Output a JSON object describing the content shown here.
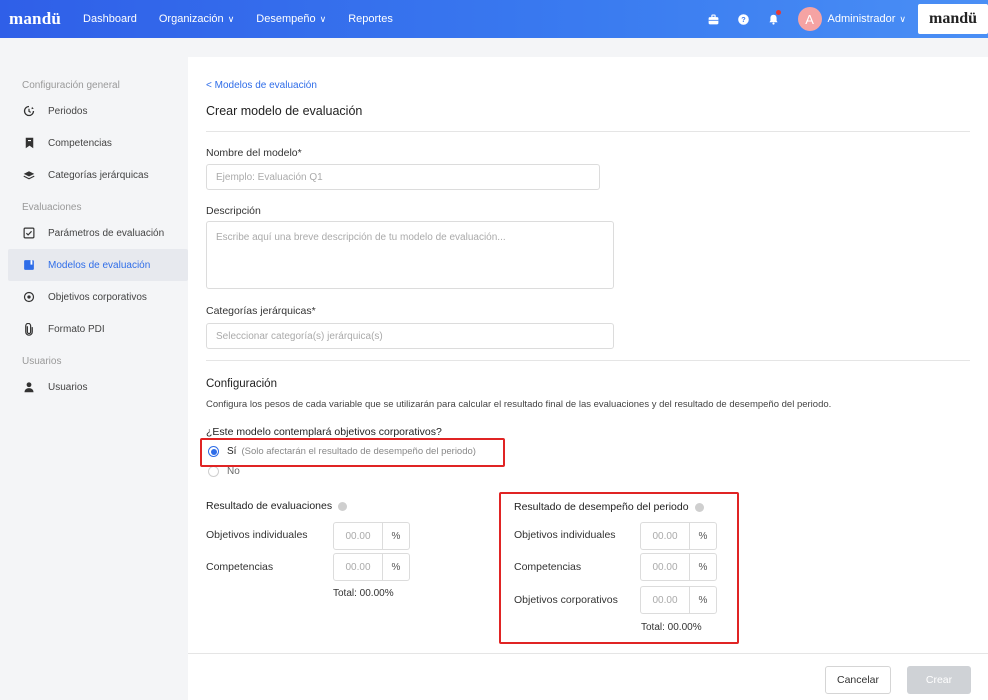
{
  "topbar": {
    "brand": "mandü",
    "nav": [
      {
        "label": "Dashboard",
        "has_dropdown": false
      },
      {
        "label": "Organización",
        "has_dropdown": true
      },
      {
        "label": "Desempeño",
        "has_dropdown": true
      },
      {
        "label": "Reportes",
        "has_dropdown": false
      }
    ],
    "avatar_initial": "A",
    "user_label": "Administrador",
    "brand_right": "mandü",
    "icons": [
      "briefcase-icon",
      "help-icon",
      "bell-icon"
    ]
  },
  "sidebar": {
    "sections": [
      {
        "title": "Configuración general",
        "items": [
          {
            "label": "Periodos",
            "icon": "clock-icon",
            "active": false
          },
          {
            "label": "Competencias",
            "icon": "bookmark-icon",
            "active": false
          },
          {
            "label": "Categorías jerárquicas",
            "icon": "layers-icon",
            "active": false
          }
        ]
      },
      {
        "title": "Evaluaciones",
        "items": [
          {
            "label": "Parámetros de evaluación",
            "icon": "checkbox-icon",
            "active": false
          },
          {
            "label": "Modelos de evaluación",
            "icon": "book-icon",
            "active": true
          },
          {
            "label": "Objetivos corporativos",
            "icon": "target-icon",
            "active": false
          },
          {
            "label": "Formato PDI",
            "icon": "paperclip-icon",
            "active": false
          }
        ]
      },
      {
        "title": "Usuarios",
        "items": [
          {
            "label": "Usuarios",
            "icon": "user-icon",
            "active": false
          }
        ]
      }
    ]
  },
  "main": {
    "breadcrumb": "< Modelos de evaluación",
    "title": "Crear modelo de evaluación",
    "name_field": {
      "label": "Nombre del modelo*",
      "placeholder": "Ejemplo: Evaluación Q1"
    },
    "description_field": {
      "label": "Descripción",
      "placeholder": "Escribe aquí una breve descripción de tu modelo de evaluación..."
    },
    "categories_field": {
      "label": "Categorías jerárquicas*",
      "placeholder": "Seleccionar categoría(s) jerárquica(s)"
    },
    "config": {
      "title": "Configuración",
      "description": "Configura los pesos de cada variable que se utilizarán para calcular el resultado final de las evaluaciones y del resultado de desempeño del periodo.",
      "question": "¿Este modelo contemplará objetivos corporativos?",
      "options": [
        {
          "label": "Sí",
          "note": "(Solo afectarán el resultado de desempeño del periodo)",
          "selected": true
        },
        {
          "label": "No",
          "note": "",
          "selected": false
        }
      ]
    },
    "evaluation_results": {
      "title": "Resultado de evaluaciones",
      "rows": [
        {
          "label": "Objetivos individuales",
          "value": "00.00",
          "unit": "%"
        },
        {
          "label": "Competencias",
          "value": "00.00",
          "unit": "%"
        }
      ],
      "total": "Total: 00.00%"
    },
    "performance_results": {
      "title": "Resultado de desempeño del periodo",
      "rows": [
        {
          "label": "Objetivos individuales",
          "value": "00.00",
          "unit": "%"
        },
        {
          "label": "Competencias",
          "value": "00.00",
          "unit": "%"
        },
        {
          "label": "Objetivos corporativos",
          "value": "00.00",
          "unit": "%"
        }
      ],
      "total": "Total: 00.00%"
    },
    "buttons": {
      "cancel": "Cancelar",
      "create": "Crear"
    }
  },
  "colors": {
    "accent": "#2f6de8",
    "highlight": "#e02424",
    "topbar": "#3a7bf0"
  }
}
